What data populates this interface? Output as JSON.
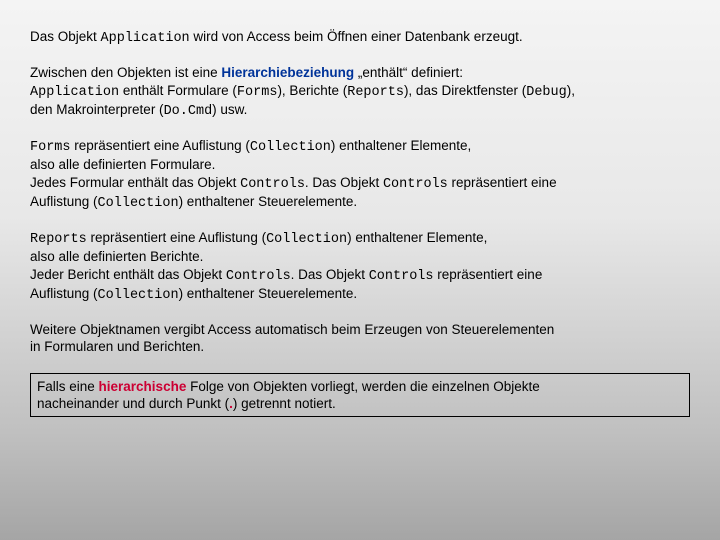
{
  "p1": {
    "t1": "Das Objekt ",
    "c1": "Application",
    "t2": " wird von Access beim Öffnen einer Datenbank erzeugt."
  },
  "p2": {
    "t1": "Zwischen den Objekten ist eine ",
    "b1": "Hierarchiebeziehung",
    "t2": "  „enthält“  definiert:",
    "c1": "Application",
    "t3": " enthält Formulare (",
    "c2": "Forms",
    "t4": "), Berichte (",
    "c3": "Reports",
    "t5": "), das Direktfenster (",
    "c4": "Debug",
    "t6": "),",
    "t7": "den Makrointerpreter (",
    "c5": "Do.Cmd",
    "t8": ") usw."
  },
  "p3": {
    "c1": "Forms",
    "t1": " repräsentiert eine Auflistung (",
    "c2": "Collection",
    "t2": ") enthaltener Elemente,",
    "t3": "also alle definierten Formulare.",
    "t4": "Jedes Formular enthält das Objekt ",
    "c3": "Controls",
    "t5": ". Das Objekt ",
    "c4": "Controls",
    "t6": " repräsentiert eine",
    "t7": "Auflistung (",
    "c5": "Collection",
    "t8": ") enthaltener Steuerelemente."
  },
  "p4": {
    "c1": "Reports",
    "t1": " repräsentiert eine Auflistung (",
    "c2": "Collection",
    "t2": ") enthaltener Elemente,",
    "t3": "also alle definierten Berichte.",
    "t4": "Jeder Bericht enthält  das Objekt ",
    "c3": "Controls",
    "t5": ". Das Objekt ",
    "c4": "Controls",
    "t6": " repräsentiert eine",
    "t7": "Auflistung (",
    "c5": "Collection",
    "t8": ") enthaltener Steuerelemente."
  },
  "p5": {
    "t1": "Weitere Objektnamen vergibt Access automatisch beim Erzeugen von Steuerelementen",
    "t2": "in Formularen und Berichten."
  },
  "box": {
    "t1": "Falls eine ",
    "r1": "hierarchische",
    "t2": " Folge von Objekten vorliegt, werden die einzelnen Objekte",
    "t3": "nacheinander und durch Punkt (",
    "r2": ".",
    "t4": ") getrennt notiert."
  }
}
